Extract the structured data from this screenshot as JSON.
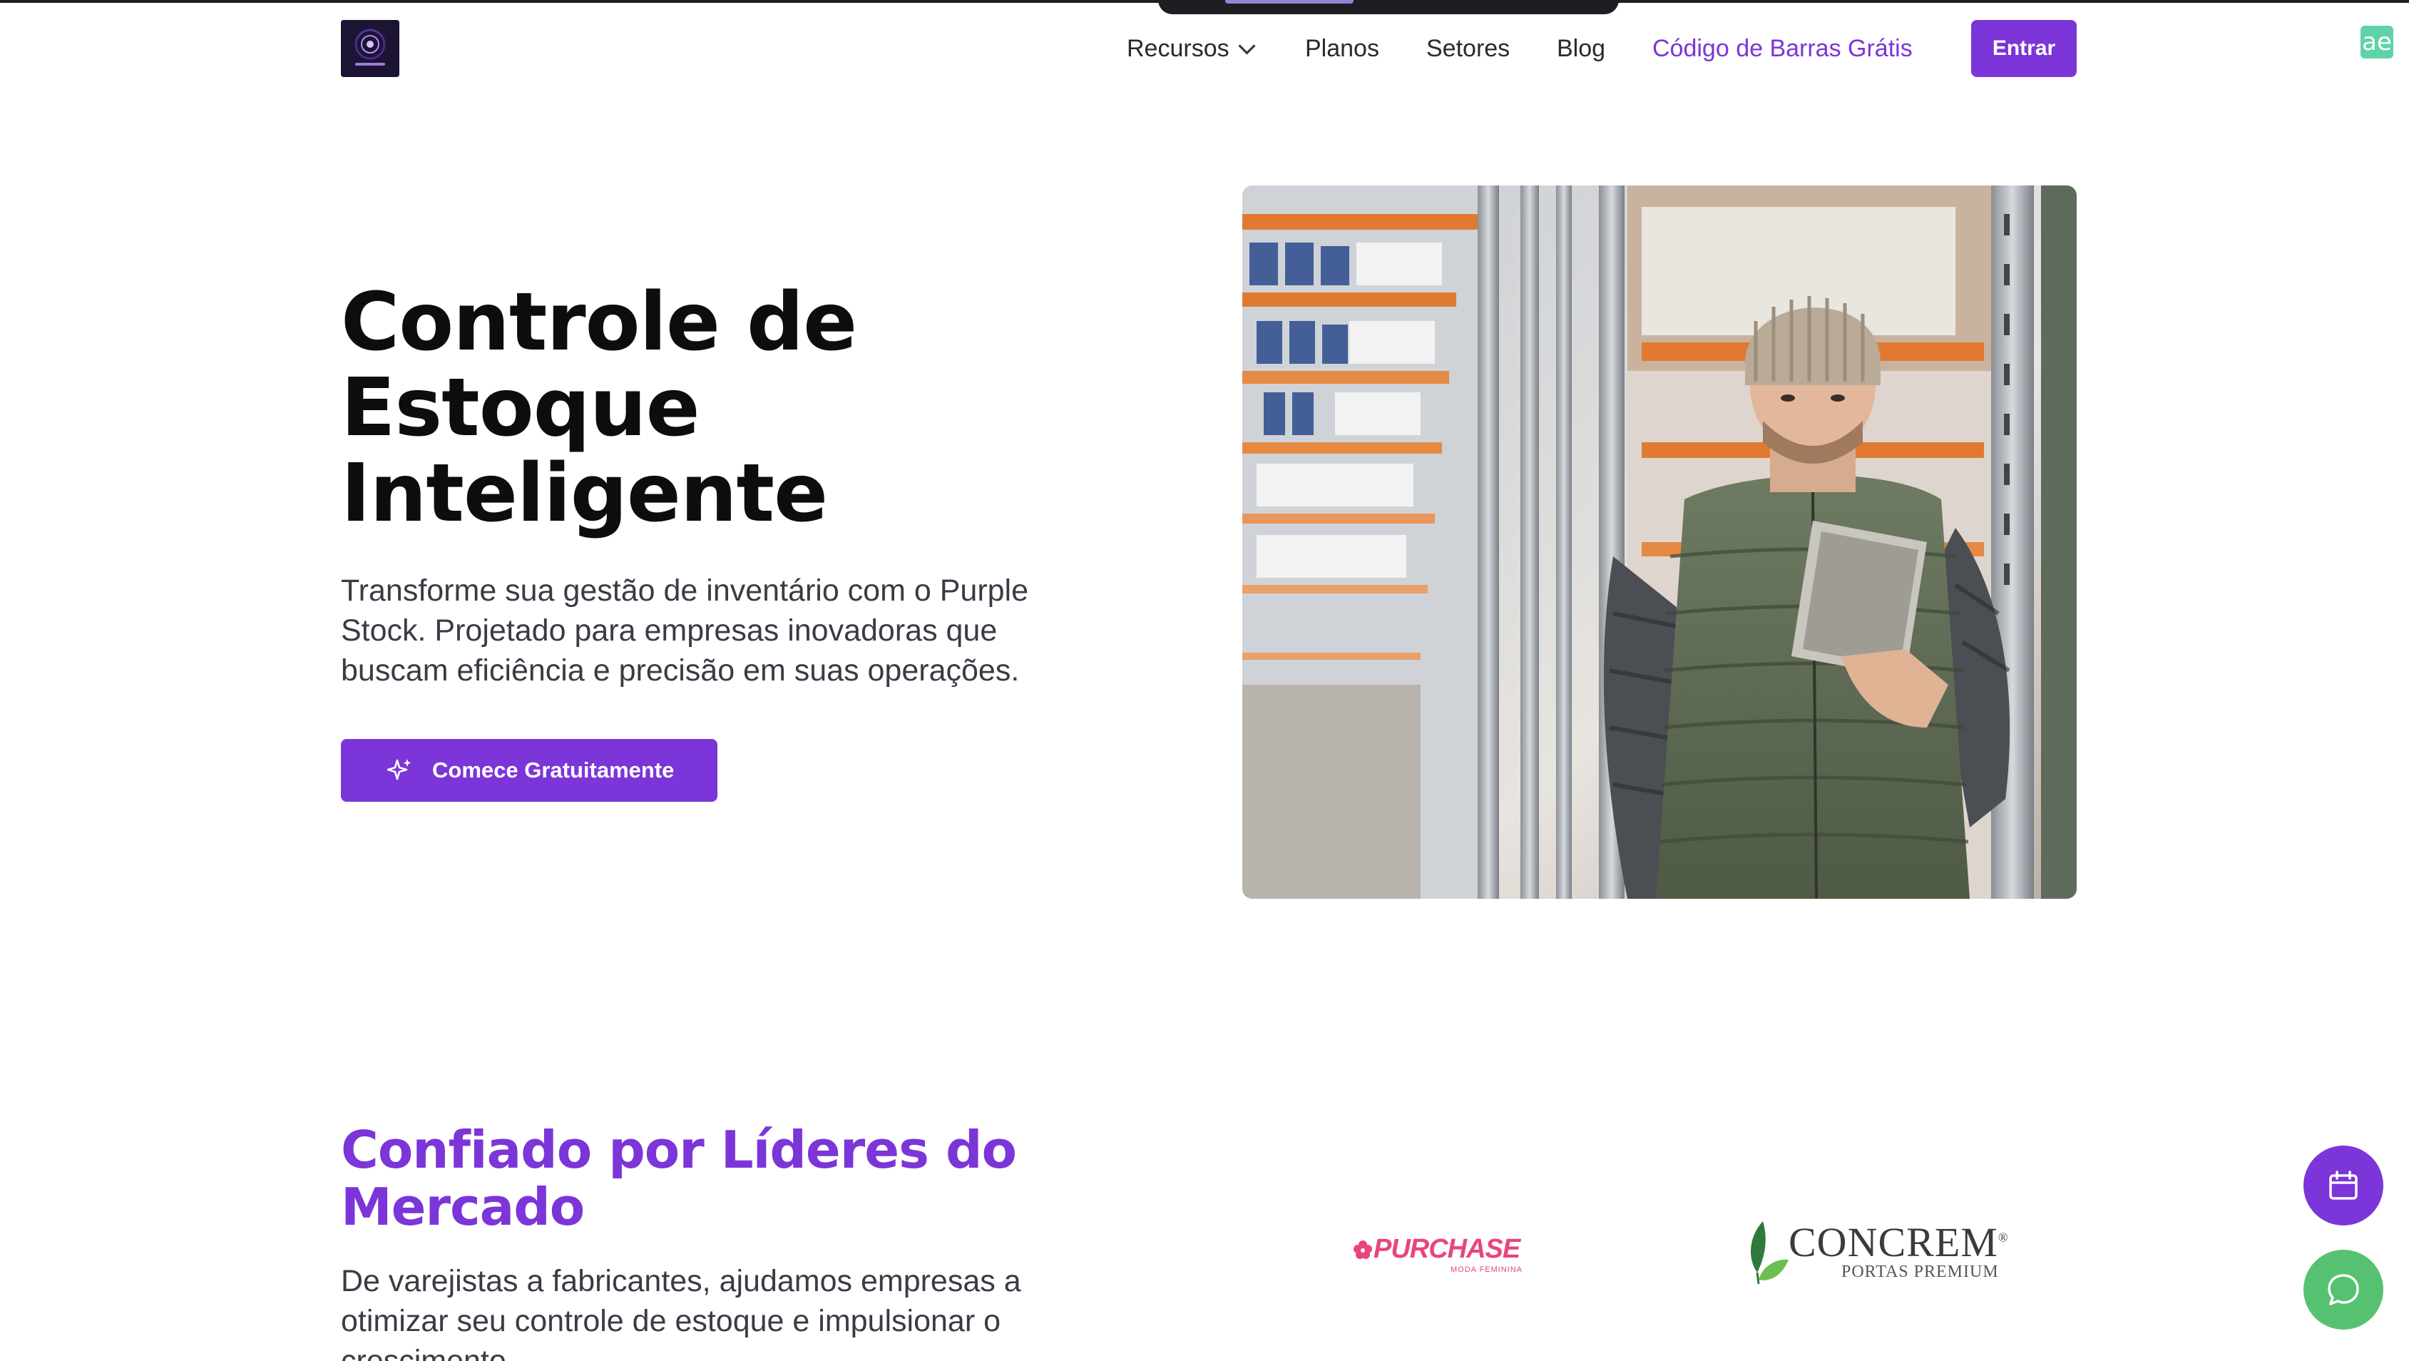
{
  "header": {
    "logo_alt": "Purple Stock",
    "nav": [
      {
        "label": "Recursos",
        "has_dropdown": true
      },
      {
        "label": "Planos"
      },
      {
        "label": "Setores"
      },
      {
        "label": "Blog"
      },
      {
        "label": "Código de Barras Grátis",
        "accent": true
      }
    ],
    "login_label": "Entrar",
    "extension_icon": "ae"
  },
  "hero": {
    "title": "Controle de Estoque Inteligente",
    "description": "Transforme sua gestão de inventário com o Purple Stock. Projetado para empresas inovadoras que buscam eficiência e precisão em suas operações.",
    "cta_label": "Comece Gratuitamente",
    "cta_icon": "sparkles-icon",
    "image_alt": "warehouse-worker-with-tablet"
  },
  "trust": {
    "title": "Confiado por Líderes do Mercado",
    "description": "De varejistas a fabricantes, ajudamos empresas a otimizar seu controle de estoque e impulsionar o crescimento.",
    "logos": {
      "purchase_name": "PURCHASE",
      "purchase_sub": "MODA FEMININA",
      "concrem_name": "CONCREM",
      "concrem_reg": "®",
      "concrem_tag": "PORTAS PREMIUM"
    }
  },
  "floating": {
    "calendar_icon": "calendar-icon",
    "chat_icon": "whatsapp-chat-icon"
  },
  "colors": {
    "accent": "#7b35d8",
    "chat": "#56c271",
    "text": "#0d0d0d",
    "muted": "#3b3b46"
  }
}
